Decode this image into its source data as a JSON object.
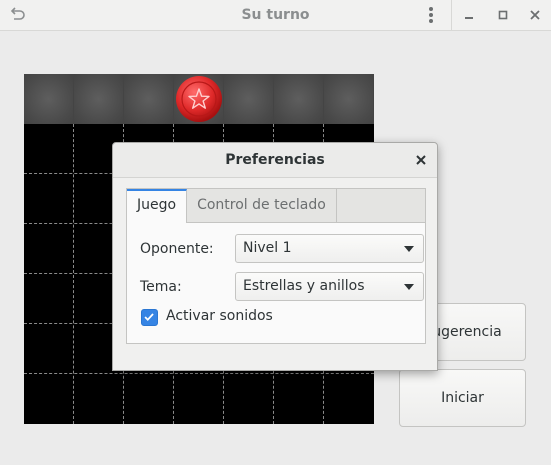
{
  "window": {
    "title": "Su turno",
    "undo_icon": "undo-icon",
    "menu_icon": "vertical-dots-icon",
    "minimize_icon": "minimize-icon",
    "maximize_icon": "maximize-icon",
    "close_icon": "close-icon"
  },
  "board": {
    "columns": 7,
    "rows": 6,
    "current_piece": {
      "column": 4,
      "color": "#d92626",
      "icon": "star-icon"
    }
  },
  "side_buttons": {
    "hint_label": "Sugerencia",
    "start_label": "Iniciar"
  },
  "dialog": {
    "title": "Preferencias",
    "close_icon": "close-icon",
    "tabs": [
      {
        "label": "Juego",
        "active": true
      },
      {
        "label": "Control de teclado",
        "active": false
      }
    ],
    "opponent": {
      "label": "Oponente:",
      "value": "Nivel 1"
    },
    "theme": {
      "label": "Tema:",
      "value": "Estrellas y anillos"
    },
    "sound": {
      "label": "Activar sonidos",
      "checked": true
    }
  },
  "colors": {
    "accent": "#3584e4",
    "piece_red": "#d92626"
  }
}
